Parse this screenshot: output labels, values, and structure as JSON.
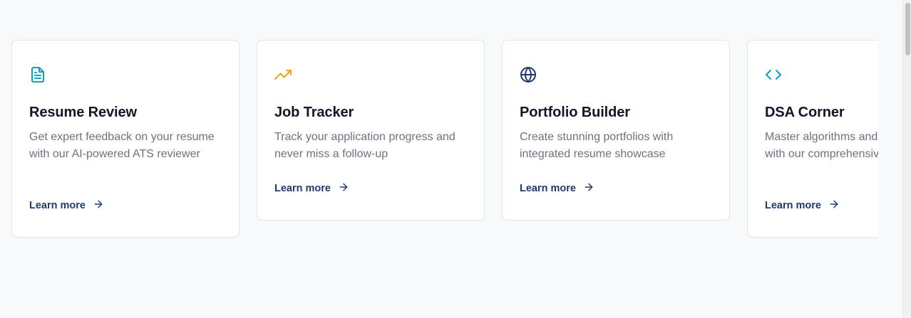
{
  "features": [
    {
      "icon": "document-icon",
      "title": "Resume Review",
      "description": "Get expert feedback on your resume with our AI-powered ATS reviewer",
      "link_label": "Learn more",
      "icon_color": "#06a3c4"
    },
    {
      "icon": "trending-up-icon",
      "title": "Job Tracker",
      "description": "Track your application progress and never miss a follow-up",
      "link_label": "Learn more",
      "icon_color": "#f0a21b"
    },
    {
      "icon": "globe-icon",
      "title": "Portfolio Builder",
      "description": "Create stunning portfolios with integrated resume showcase",
      "link_label": "Learn more",
      "icon_color": "#1e3a6e"
    },
    {
      "icon": "code-icon",
      "title": "DSA Corner",
      "description": "Master algorithms and data structures with our comprehensive guides",
      "link_label": "Learn more",
      "icon_color": "#06a3c4"
    }
  ],
  "colors": {
    "title": "#101828",
    "description": "#6b7280",
    "link": "#1e3a6e",
    "background": "#f8f9fb"
  }
}
